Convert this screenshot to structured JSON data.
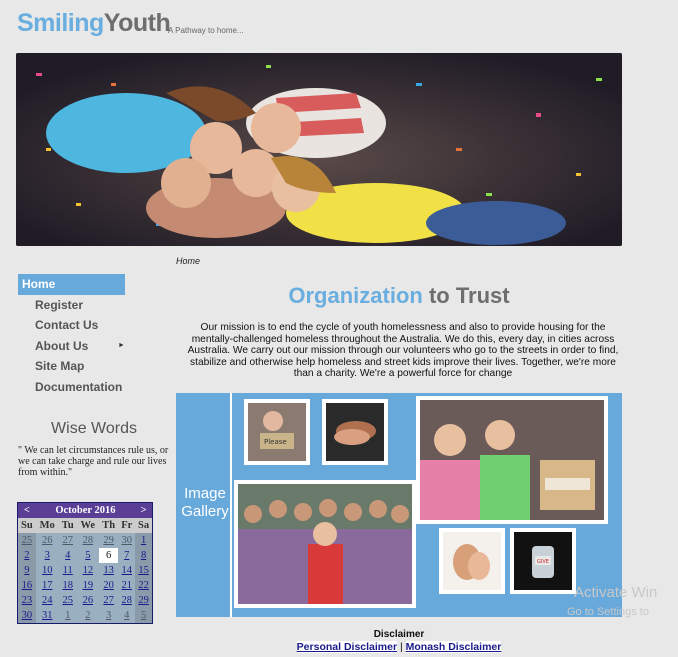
{
  "header": {
    "logo_part1": "Smiling",
    "logo_part2": "Youth",
    "tagline": "A Pathway to home..."
  },
  "breadcrumb": "Home",
  "nav": {
    "items": [
      {
        "label": "Home"
      },
      {
        "label": "Register"
      },
      {
        "label": "Contact Us"
      },
      {
        "label": "About Us"
      },
      {
        "label": "Site Map"
      },
      {
        "label": "Documentation"
      }
    ],
    "submenu_arrow": "►"
  },
  "wise_words": {
    "title": "Wise Words",
    "quote": "\" We can let circumstances rule us, or we can take charge and rule our lives from within.\""
  },
  "calendar": {
    "prev": "<",
    "next": ">",
    "month_label": "October 2016",
    "days_of_week": [
      "Su",
      "Mo",
      "Tu",
      "We",
      "Th",
      "Fr",
      "Sa"
    ],
    "weeks": [
      [
        "25",
        "26",
        "27",
        "28",
        "29",
        "30",
        "1"
      ],
      [
        "2",
        "3",
        "4",
        "5",
        "6",
        "7",
        "8"
      ],
      [
        "9",
        "10",
        "11",
        "12",
        "13",
        "14",
        "15"
      ],
      [
        "16",
        "17",
        "18",
        "19",
        "20",
        "21",
        "22"
      ],
      [
        "23",
        "24",
        "25",
        "26",
        "27",
        "28",
        "29"
      ],
      [
        "30",
        "31",
        "1",
        "2",
        "3",
        "4",
        "5"
      ]
    ],
    "today": "6"
  },
  "main": {
    "heading_part1": "Organization",
    "heading_part2": " to Trust",
    "mission": "Our mission is to end the cycle of youth homelessness and also to provide housing for the mentally-challenged homeless throughout the Australia. We do this, every day, in cities across Australia. We carry out our mission through our volunteers who go to the streets in order to find, stabilize and otherwise help homeless and street kids improve their lives. Together, we're more than a charity. We're a powerful force for change"
  },
  "gallery": {
    "label_line1": "Image",
    "label_line2": "Gallery"
  },
  "disclaimer": {
    "title": "Disclaimer",
    "personal_link": "Personal Disclaimer",
    "separator": " | ",
    "monash_link": "Monash Disclaimer"
  },
  "watermark": {
    "line1": "Activate Win",
    "line2": "Go to Settings to"
  }
}
